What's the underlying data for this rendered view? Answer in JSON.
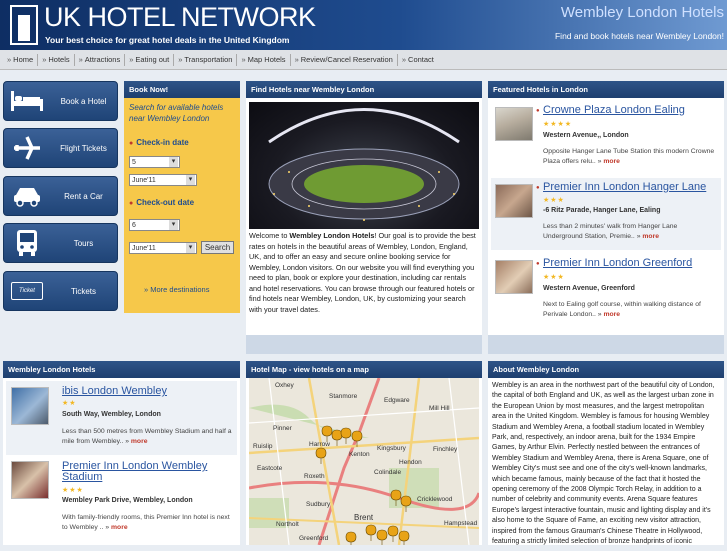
{
  "header": {
    "brand": "UK HOTEL NETWORK",
    "tagline": "Your best choice for great hotel deals in the United Kingdom",
    "city_title": "Wembley London Hotels",
    "city_subtitle": "Find and book hotels near Wembley London!"
  },
  "nav": [
    "Home",
    "Hotels",
    "Attractions",
    "Eating out",
    "Transportation",
    "Map Hotels",
    "Review/Cancel Reservation",
    "Contact"
  ],
  "side_buttons": [
    {
      "label": "Book a Hotel",
      "icon": "bed-icon"
    },
    {
      "label": "Flight Tickets",
      "icon": "airplane-icon"
    },
    {
      "label": "Rent a Car",
      "icon": "car-icon"
    },
    {
      "label": "Tours",
      "icon": "bus-icon"
    },
    {
      "label": "Tickets",
      "icon": "ticket-icon",
      "icon_text": "Ticket"
    }
  ],
  "book": {
    "title": "Book Now!",
    "intro": "Search for available hotels near Wembley London",
    "checkin_label": "Check-in date",
    "checkin_day": "5",
    "checkin_month": "June'11",
    "checkout_label": "Check-out date",
    "checkout_day": "6",
    "checkout_month": "June'11",
    "search_label": "Search",
    "more_destinations": "More destinations"
  },
  "find": {
    "title": "Find Hotels near Wembley London",
    "text_pre": "Welcome to ",
    "text_bold": "Wembley London Hotels",
    "text_post": "! Our goal is to provide the best rates on hotels in the beautiful areas of Wembley, London, England, UK, and to offer an easy and secure online booking service for Wembley, London visitors. On our website you will find everything you need to plan, book or explore your destination, including car rentals and hotel reservations. You can browse through our featured hotels or find hotels near Wembley, London, UK, by customizing your search with your travel dates."
  },
  "featured": {
    "title": "Featured Hotels in London",
    "hotels": [
      {
        "name": "Crowne Plaza London Ealing",
        "stars": "★★★★",
        "address": "Western Avenue,, London",
        "desc": "Opposite Hanger Lane Tube Station this modern Crowne Plaza offers relu..",
        "more": "more"
      },
      {
        "name": "Premier Inn London Hanger Lane",
        "stars": "★★★",
        "address": "-6 Ritz Parade, Hanger Lane, Ealing",
        "desc": "Less than 2 minutes' walk from Hanger Lane Underground Station, Premie..",
        "more": "more"
      },
      {
        "name": "Premier Inn London Greenford",
        "stars": "★★★",
        "address": "Western Avenue, Greenford",
        "desc": "Next to Ealing golf course, within walking distance of Perivale London..",
        "more": "more"
      }
    ]
  },
  "wembley_hotels": {
    "title": "Wembley London Hotels",
    "hotels": [
      {
        "name": "ibis London Wembley",
        "stars": "★★",
        "address": "South Way, Wembley, London",
        "desc": "Less than 500 metres from Wembley Stadium and half a mile from Wembley..",
        "more": "more"
      },
      {
        "name": "Premier Inn London Wembley Stadium",
        "stars": "★★★",
        "address": "Wembley Park Drive, Wembley, London",
        "desc": "With family-friendly rooms, this Premier Inn hotel is next to Wembley ..",
        "more": "more"
      }
    ]
  },
  "hotel_map": {
    "title": "Hotel Map - view hotels on a map",
    "places": [
      "Oxhey",
      "Stanmore",
      "Edgware",
      "Mill Hill",
      "Pinner",
      "Harrow",
      "Finchley",
      "Ruislip",
      "Kenton",
      "Kingsbury",
      "Hendon",
      "Eastcote",
      "Roxeth",
      "Colindale",
      "Cricklewood",
      "Sudbury",
      "Brent",
      "Northolt",
      "Greenford",
      "Hampstead"
    ],
    "colors": {
      "pin": "#e8a317",
      "park": "#bcd9a0",
      "motorway": "#e9807f",
      "road": "#f4d37b"
    }
  },
  "about": {
    "title": "About Wembley London",
    "text": "Wembley is an area in the northwest part of the beautiful city of London, the capital of both England and UK, as well as the largest urban zone in the European Union by most measures, and the largest metropolitan area in the United Kingdom. Wembley is famous for housing Wembley Stadium and Wembley Arena, a football stadium located in Wembley Park, and, respectively, an indoor arena, built for the 1934 Empire Games, by Arthur Elvin. Perfectly nestled between the entrances of Wembley Stadium and Wembley Arena, there is Arena Square, one of Wembley City's must see and one of the city's well-known landmarks, which became famous, mainly because of the fact that it hosted the opening ceremony of the 2008 Olympic Torch Relay, in addition to a number of celebrity and community events. Arena Square features Europe's largest interactive fountain, music and lighting display and it's also home to the Square of Fame, an exciting new visitor attraction, inspired from the famous Grauman's Chinese Theatre in Hollywood, featuring a strictly limited selection of bronze handprints of iconic"
  },
  "colors": {
    "header_dark": "#0e2e63",
    "accent_blue": "#2a55a0",
    "book_bg": "#f6c84a",
    "more_red": "#c0392b",
    "star": "#f2b824"
  }
}
